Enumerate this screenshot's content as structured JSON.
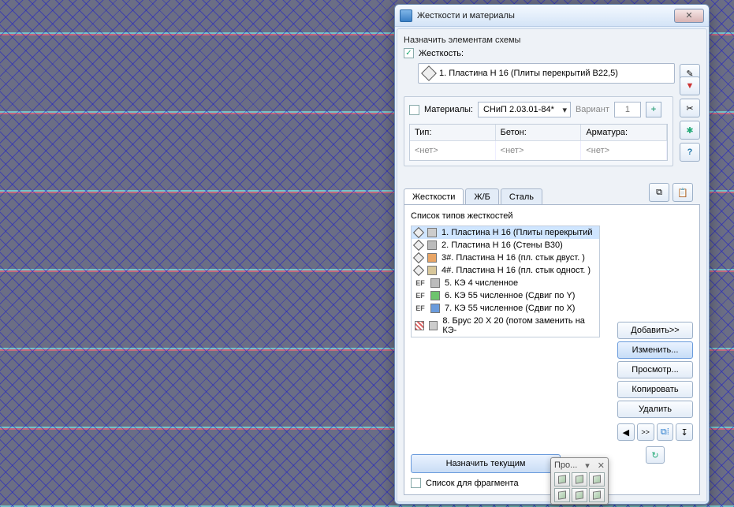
{
  "window": {
    "title": "Жесткости и материалы",
    "close_glyph": "✕"
  },
  "assign": {
    "section": "Назначить элементам схемы",
    "stiffness_cb": "Жесткость:",
    "current": "1. Пластина  H 16 (Плиты перекрытий B22,5)"
  },
  "materials": {
    "cb": "Материалы:",
    "code": "СНиП 2.03.01-84*",
    "variant_label": "Вариант",
    "variant": "1",
    "cols": {
      "type": "Тип:",
      "concrete": "Бетон:",
      "rebar": "Арматура:"
    },
    "empty": "<нет>"
  },
  "tabs": {
    "t1": "Жесткости",
    "t2": "Ж/Б",
    "t3": "Сталь"
  },
  "list": {
    "title": "Список типов жесткостей",
    "items": [
      "1. Пластина  H 16 (Плиты перекрытий",
      "2. Пластина  H 16 (Стены B30)",
      "3#. Пластина  H 16 (пл. стык двуст. )",
      "4#. Пластина  H 16 (пл. стык одност. )",
      "5. КЭ 4 численное",
      "6. КЭ 55 численное (Сдвиг по Y)",
      "7. КЭ 55 численное (Сдвиг по X)",
      "8. Брус 20 X 20 (потом заменить на КЭ-"
    ]
  },
  "buttons": {
    "add": "Добавить>>",
    "edit": "Изменить...",
    "view": "Просмотр...",
    "copy": "Копировать",
    "del": "Удалить"
  },
  "assign_current": "Назначить текущим",
  "fragment": "Список для фрагмента",
  "palette": {
    "title": "Про...",
    "close": "✕"
  },
  "glyphs": {
    "pencil": "✎",
    "filter": "▼",
    "scissors": "✂",
    "marker": "✱",
    "help": "?",
    "copy": "⧉",
    "paste": "📋",
    "left": "◀",
    "right": ">>",
    "link": "⧉⁞",
    "axis": "↧",
    "refresh": "↻"
  }
}
